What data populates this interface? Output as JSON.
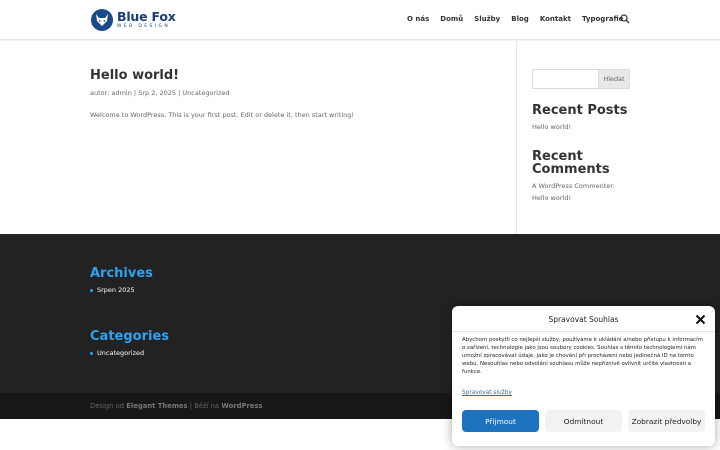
{
  "logo": {
    "main": "Blue Fox",
    "sub": "WEB DESIGN"
  },
  "nav": {
    "items": [
      "O nás",
      "Domů",
      "Služby",
      "Blog",
      "Kontakt",
      "Typografie"
    ]
  },
  "post": {
    "title": "Hello world!",
    "meta": {
      "prefix": "autor:",
      "author": "admin",
      "sep1": "|",
      "date": "Srp 2, 2025",
      "sep2": "|",
      "category": "Uncategorized"
    },
    "body": "Welcome to WordPress. This is your first post. Edit or delete it, then start writing!"
  },
  "sidebar": {
    "search_button": "Hledat",
    "search_placeholder": "",
    "recent_posts_title": "Recent Posts",
    "recent_posts": [
      "Hello world!"
    ],
    "recent_comments_title_1": "Recent",
    "recent_comments_title_2": "Comments",
    "comment_author": "A WordPress Commenter:",
    "comment_post": "Hello world!"
  },
  "footer": {
    "archives_title": "Archives",
    "archives": [
      "Srpen 2025"
    ],
    "categories_title": "Categories",
    "categories": [
      "Uncategorized"
    ],
    "credits_prefix": "Design od",
    "credits_theme": "Elegant Themes",
    "credits_mid": "| Běží na",
    "credits_wp": "WordPress"
  },
  "consent": {
    "title": "Spravovat Souhlas",
    "text": "Abychom poskytli co nejlepší služby, používáme k ukládání a/nebo přístupu k informacím o zařízení, technologie jako jsou soubory cookies. Souhlas s těmito technologiemi nám umožní zpracovávat údaje, jako je chování při procházení nebo jedinečná ID na tomto webu. Nesouhlas nebo odvolání souhlasu může nepříznivě ovlivnit určité vlastnosti a funkce.",
    "manage_link": "Spravovat služby",
    "accept": "Přijmout",
    "deny": "Odmítnout",
    "prefs": "Zobrazit předvolby"
  },
  "colors": {
    "accent": "#2ea3f2",
    "brand": "#1a3e78",
    "button_primary": "#1e73be",
    "footer_bg": "#222222",
    "bottom_bar_bg": "#171717"
  }
}
